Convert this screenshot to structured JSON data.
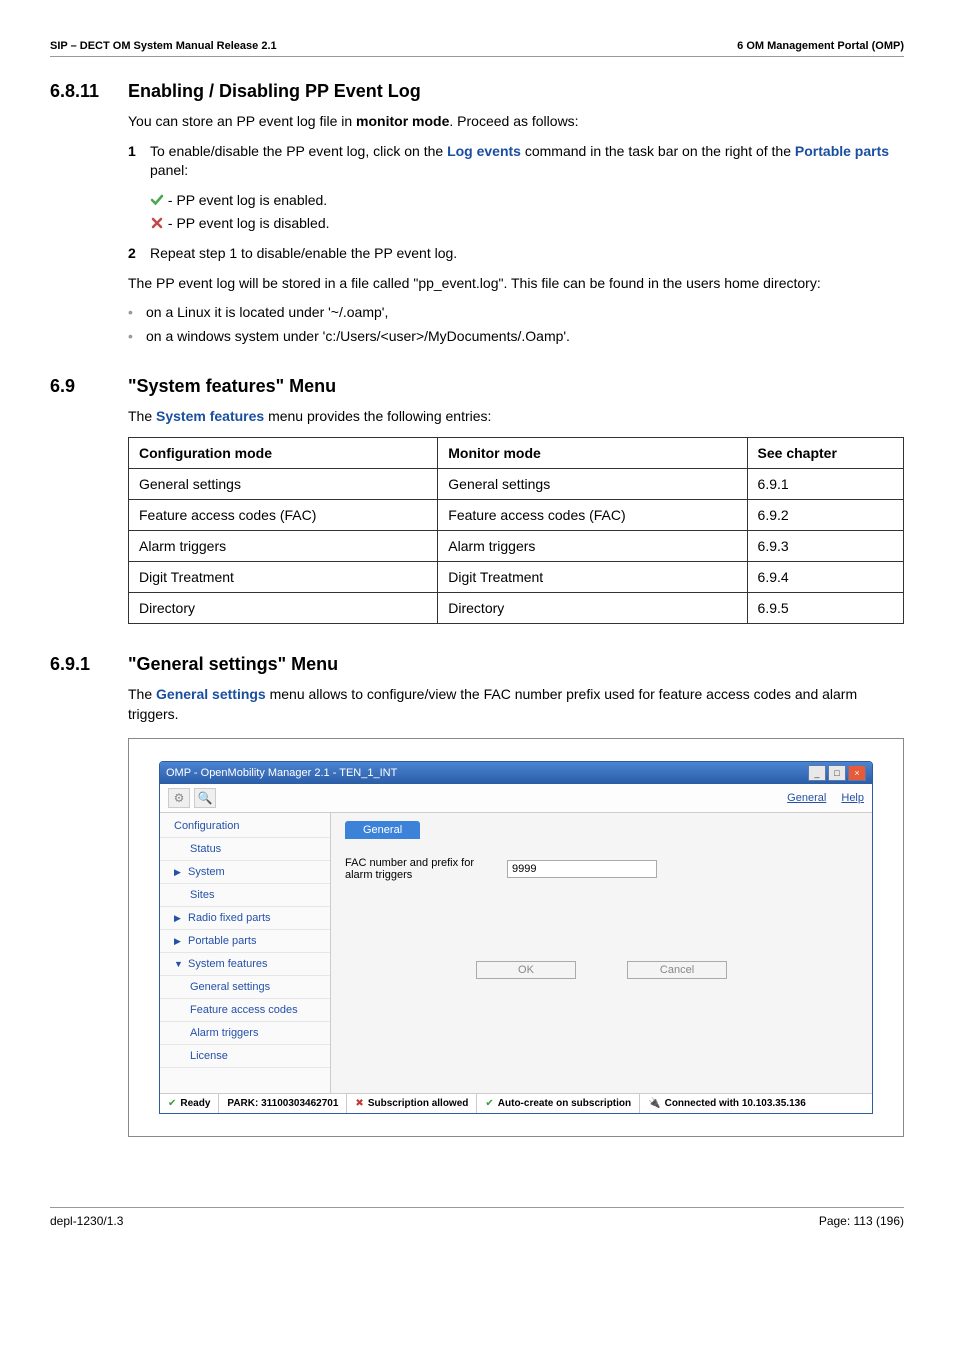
{
  "header": {
    "left": "SIP – DECT OM System Manual Release 2.1",
    "right": "6 OM Management Portal (OMP)"
  },
  "s6811": {
    "num": "6.8.11",
    "title": "Enabling / Disabling PP Event Log",
    "intro_pre": "You can store an PP event log file in ",
    "intro_bold": "monitor mode",
    "intro_post": ". Proceed as follows:",
    "step1_pre": "To enable/disable the PP event log, click on the ",
    "step1_link1": "Log events",
    "step1_mid": " command in the task bar on the right of the ",
    "step1_link2": "Portable parts",
    "step1_post": " panel:",
    "enabled": " - PP event log is enabled.",
    "disabled": " - PP event log is disabled.",
    "step2": "Repeat step 1 to disable/enable the PP event log.",
    "stored": "The PP event log will be stored in a file called \"pp_event.log\". This file can be found in the users home directory:",
    "b1": "on a Linux it is located under '~/.oamp',",
    "b2": "on a windows system under 'c:/Users/<user>/MyDocuments/.Oamp'."
  },
  "s69": {
    "num": "6.9",
    "title": "\"System features\" Menu",
    "intro_pre": "The ",
    "intro_link": "System features",
    "intro_post": " menu provides the following entries:",
    "head": {
      "c1": "Configuration mode",
      "c2": "Monitor mode",
      "c3": "See chapter"
    },
    "rows": [
      {
        "c1": "General settings",
        "c2": "General settings",
        "c3": "6.9.1"
      },
      {
        "c1": "Feature access codes (FAC)",
        "c2": "Feature access codes (FAC)",
        "c3": "6.9.2"
      },
      {
        "c1": "Alarm triggers",
        "c2": "Alarm triggers",
        "c3": "6.9.3"
      },
      {
        "c1": "Digit Treatment",
        "c2": "Digit Treatment",
        "c3": "6.9.4"
      },
      {
        "c1": "Directory",
        "c2": "Directory",
        "c3": "6.9.5"
      }
    ]
  },
  "s691": {
    "num": "6.9.1",
    "title": "\"General settings\" Menu",
    "intro_pre": "The ",
    "intro_link": "General settings",
    "intro_post": " menu allows to configure/view the FAC number prefix used for feature access codes and alarm triggers."
  },
  "ss": {
    "title": "OMP - OpenMobility Manager 2.1 - TEN_1_INT",
    "menu_general": "General",
    "menu_help": "Help",
    "side": {
      "configuration": "Configuration",
      "status": "Status",
      "system": "System",
      "sites": "Sites",
      "rfp": "Radio fixed parts",
      "pp": "Portable parts",
      "sf": "System features",
      "gs": "General settings",
      "fac": "Feature access codes",
      "at": "Alarm triggers",
      "lic": "License"
    },
    "tab": "General",
    "form_label": "FAC number and prefix for alarm triggers",
    "form_value": "9999",
    "ok": "OK",
    "cancel": "Cancel",
    "status": {
      "ready": "Ready",
      "park": "PARK: 31100303462701",
      "sub": "Subscription allowed",
      "auto": "Auto-create on subscription",
      "conn": "Connected with 10.103.35.136"
    }
  },
  "footer": {
    "left": "depl-1230/1.3",
    "right": "Page: 113 (196)"
  }
}
